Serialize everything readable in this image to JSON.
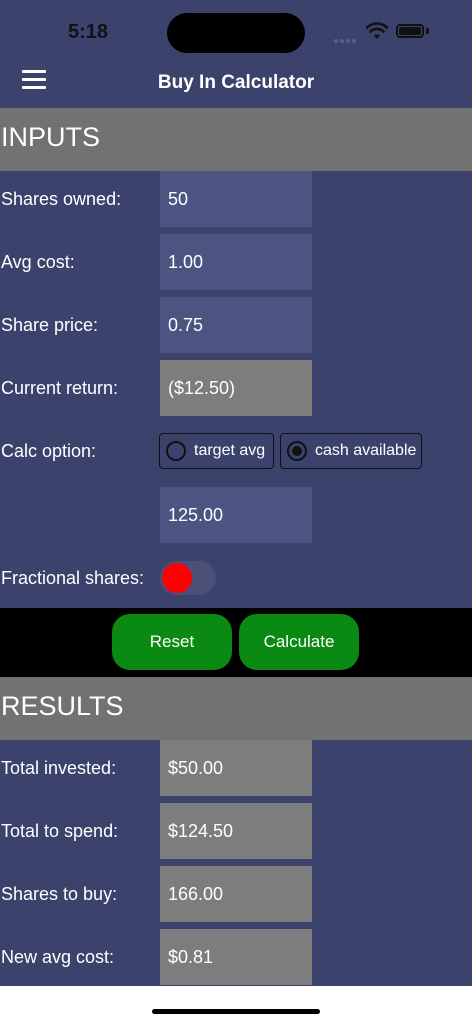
{
  "status": {
    "time": "5:18"
  },
  "nav": {
    "title": "Buy In Calculator"
  },
  "inputs": {
    "header": "INPUTS",
    "shares_owned": {
      "label": "Shares owned:",
      "value": "50"
    },
    "avg_cost": {
      "label": "Avg cost:",
      "value": "1.00"
    },
    "share_price": {
      "label": "Share price:",
      "value": "0.75"
    },
    "current_return": {
      "label": "Current return:",
      "value": "($12.50)"
    },
    "calc_option": {
      "label": "Calc option:",
      "options": [
        "target avg",
        "cash available"
      ],
      "selected": "cash available"
    },
    "calc_value": "125.00",
    "fractional": {
      "label": "Fractional shares:",
      "enabled": false
    }
  },
  "actions": {
    "reset": "Reset",
    "calculate": "Calculate"
  },
  "results": {
    "header": "RESULTS",
    "total_invested": {
      "label": "Total invested:",
      "value": "$50.00"
    },
    "total_to_spend": {
      "label": "Total to spend:",
      "value": "$124.50"
    },
    "shares_to_buy": {
      "label": "Shares to buy:",
      "value": "166.00"
    },
    "new_avg_cost": {
      "label": "New avg cost:",
      "value": "$0.81"
    }
  },
  "colors": {
    "background": "#3b436c",
    "section_header": "#727272",
    "input_field": "#4c5482",
    "readonly_field": "#7d7d7d",
    "button": "#0a8a12",
    "toggle_knob": "#ff0000"
  }
}
